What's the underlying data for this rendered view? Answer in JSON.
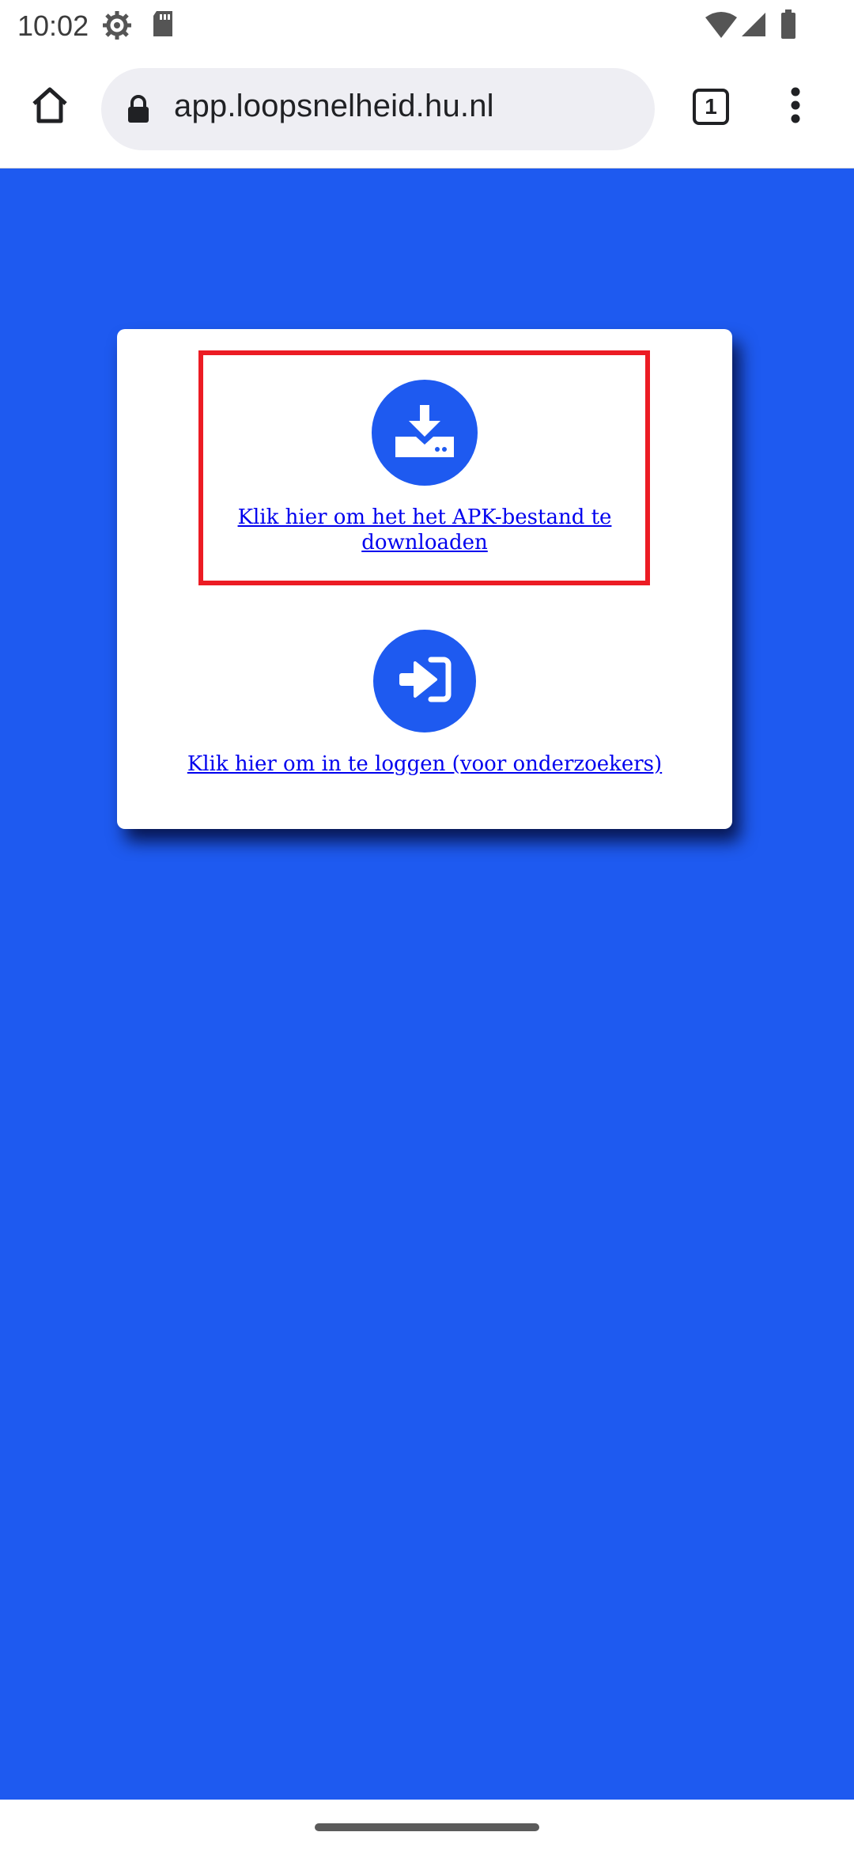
{
  "status_bar": {
    "time": "10:02",
    "icons": [
      "settings-gear-icon",
      "sd-card-icon",
      "wifi-icon",
      "cell-signal-icon",
      "battery-icon"
    ]
  },
  "browser": {
    "url": "app.loopsnelheid.hu.nl",
    "tab_count": "1",
    "icons": [
      "home-icon",
      "lock-icon",
      "tab-switcher-icon",
      "more-vert-icon"
    ]
  },
  "page": {
    "background_color": "#1e5af0",
    "download": {
      "icon": "download-icon",
      "label": "Klik hier om het het APK-bestand te downloaden"
    },
    "login": {
      "icon": "sign-in-icon",
      "label": "Klik hier om in te loggen (voor onderzoekers)"
    }
  },
  "highlight": {
    "color": "#ec1c24"
  }
}
